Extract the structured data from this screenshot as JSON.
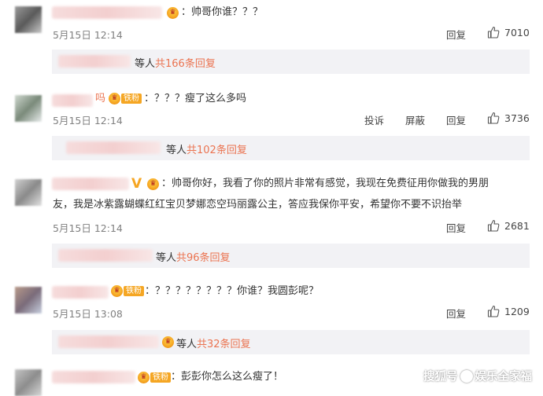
{
  "comments": [
    {
      "text": "：帅哥你谁？？？",
      "date": "5月15日 12:14",
      "actions": {
        "reply": "回复"
      },
      "likes": "7010",
      "replies": {
        "prefix": "等人",
        "link": "共166条回复"
      }
    },
    {
      "name_tail": "吗",
      "badge": "铁粉",
      "text": "：？？？瘦了这么多吗",
      "date": "5月15日 12:14",
      "actions": {
        "report": "投诉",
        "block": "屏蔽",
        "reply": "回复"
      },
      "likes": "3736",
      "replies": {
        "prefix": "等人",
        "link": "共102条回复"
      }
    },
    {
      "text_line1": "：帅哥你好，我看了你的照片非常有感觉，我现在免费征用你做我的男朋",
      "text_line2": "友，我是冰紫露蝴蝶红红宝贝梦娜恋空玛丽露公主，答应我保你平安，希望你不要不识抬举",
      "date": "5月15日 12:14",
      "actions": {
        "reply": "回复"
      },
      "likes": "2681",
      "replies": {
        "prefix": "等人",
        "link": "共96条回复"
      }
    },
    {
      "badge": "铁粉",
      "text": "：？？？？？？？？你谁？我圆彭呢？",
      "date": "5月15日 13:08",
      "actions": {
        "reply": "回复"
      },
      "likes": "1209",
      "replies": {
        "prefix": "等人",
        "link": "共32条回复"
      }
    },
    {
      "badge": "铁粉",
      "text": "：彭彭你怎么这么瘦了！"
    }
  ],
  "watermark": {
    "left": "搜狐号",
    "right": "娱乐全家福"
  },
  "colors": {
    "link": "#eb7350",
    "badge": "#f5a623",
    "replybox": "#f2f2f5"
  }
}
